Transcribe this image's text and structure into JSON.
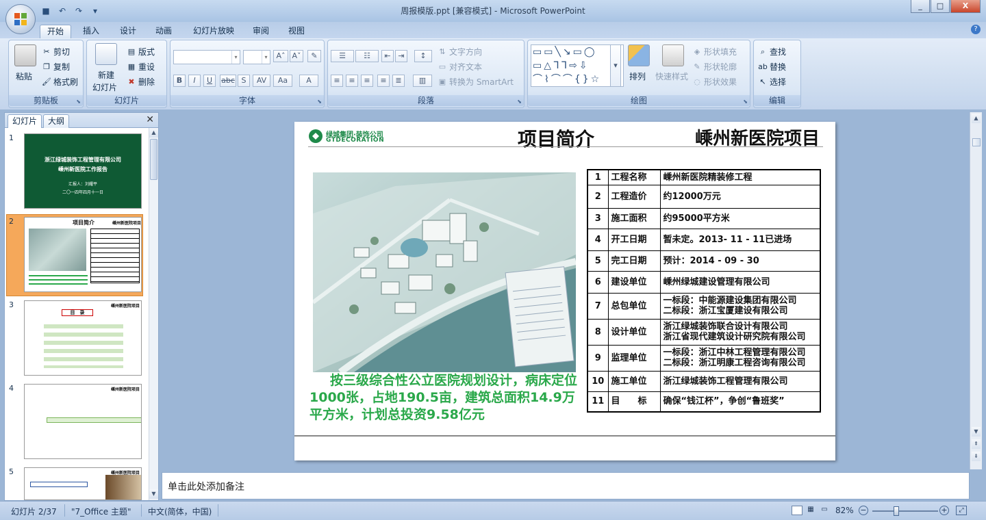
{
  "window": {
    "title": "周报模版.ppt [兼容模式] - Microsoft PowerPoint",
    "controls": {
      "minimize": "_",
      "maximize": "□",
      "close": "X"
    }
  },
  "quick_access": [
    "save-icon",
    "undo-icon",
    "redo-icon",
    "customize-icon"
  ],
  "tabs": [
    "开始",
    "插入",
    "设计",
    "动画",
    "幻灯片放映",
    "审阅",
    "视图"
  ],
  "active_tab": "开始",
  "ribbon": {
    "clipboard": {
      "paste": "粘贴",
      "cut": "剪切",
      "copy": "复制",
      "format_painter": "格式刷",
      "label": "剪贴板"
    },
    "slides": {
      "new_slide_line1": "新建",
      "new_slide_line2": "幻灯片",
      "layout": "版式",
      "reset": "重设",
      "delete": "删除",
      "label": "幻灯片"
    },
    "font": {
      "label": "字体",
      "font_name": "",
      "font_size": ""
    },
    "paragraph": {
      "text_direction": "文字方向",
      "align_text": "对齐文本",
      "smartart": "转换为 SmartArt",
      "label": "段落"
    },
    "drawing": {
      "arrange": "排列",
      "quick_styles": "快速样式",
      "shape_fill": "形状填充",
      "shape_outline": "形状轮廓",
      "shape_effects": "形状效果",
      "label": "绘图"
    },
    "editing": {
      "find": "查找",
      "replace": "替换",
      "select": "选择",
      "label": "编辑"
    }
  },
  "pane": {
    "tab_slides": "幻灯片",
    "tab_outline": "大纲",
    "thumbnails": [
      {
        "num": "1",
        "line1": "浙江绿城装饰工程管理有限公司",
        "line2": "嵊州新医院工作报告",
        "line3": "汇报人：刘耀平",
        "line4": "二〇一四年四月十一日"
      },
      {
        "num": "2",
        "title": "项目简介",
        "title2": "嵊州新医院项目"
      },
      {
        "num": "3",
        "title": "目　录",
        "title2": "嵊州新医院项目"
      },
      {
        "num": "4",
        "title2": "嵊州新医院项目"
      },
      {
        "num": "5",
        "title2": "嵊州新医院项目"
      }
    ]
  },
  "slide": {
    "logo_line1": "绿城集团·装饰公司",
    "logo_line2": "GTDECORATION",
    "title": "项目简介",
    "title2": "嵊州新医院项目",
    "caption": "按三级综合性公立医院规划设计，病床定位1000张，占地190.5亩，建筑总面积14.9万平方米，计划总投资9.58亿元",
    "table": [
      {
        "num": "1",
        "label": "工程名称",
        "value": "嵊州新医院精装修工程"
      },
      {
        "num": "2",
        "label": "工程造价",
        "value": "约12000万元"
      },
      {
        "num": "3",
        "label": "施工面积",
        "value": "约95000平方米"
      },
      {
        "num": "4",
        "label": "开工日期",
        "value": "暂未定。2013- 11 - 11已进场"
      },
      {
        "num": "5",
        "label": "完工日期",
        "value": "预计：2014 - 09 - 30"
      },
      {
        "num": "6",
        "label": "建设单位",
        "value": "嵊州绿城建设管理有限公司"
      },
      {
        "num": "7",
        "label": "总包单位",
        "value": "一标段：中能源建设集团有限公司",
        "value2": "二标段：浙江宝厦建设有限公司"
      },
      {
        "num": "8",
        "label": "设计单位",
        "value": "浙江绿城装饰联合设计有限公司",
        "value2": "浙江省现代建筑设计研究院有限公司"
      },
      {
        "num": "9",
        "label": "监理单位",
        "value": "一标段：浙江中林工程管理有限公司",
        "value2": "二标段：浙江明康工程咨询有限公司"
      },
      {
        "num": "10",
        "label": "施工单位",
        "value": "浙江绿城装饰工程管理有限公司"
      },
      {
        "num": "11",
        "label": "目　　标",
        "value": "确保“钱江杯”，争创“鲁班奖”"
      }
    ]
  },
  "notes_placeholder": "单击此处添加备注",
  "status": {
    "slide_pos": "幻灯片 2/37",
    "theme": "\"7_Office 主题\"",
    "language": "中文(简体，中国)",
    "zoom": "82%"
  },
  "colors": {
    "accent_green": "#2aa84a",
    "selected_thumb": "#f5a85a",
    "ribbon_blue": "#c3d4ec"
  }
}
